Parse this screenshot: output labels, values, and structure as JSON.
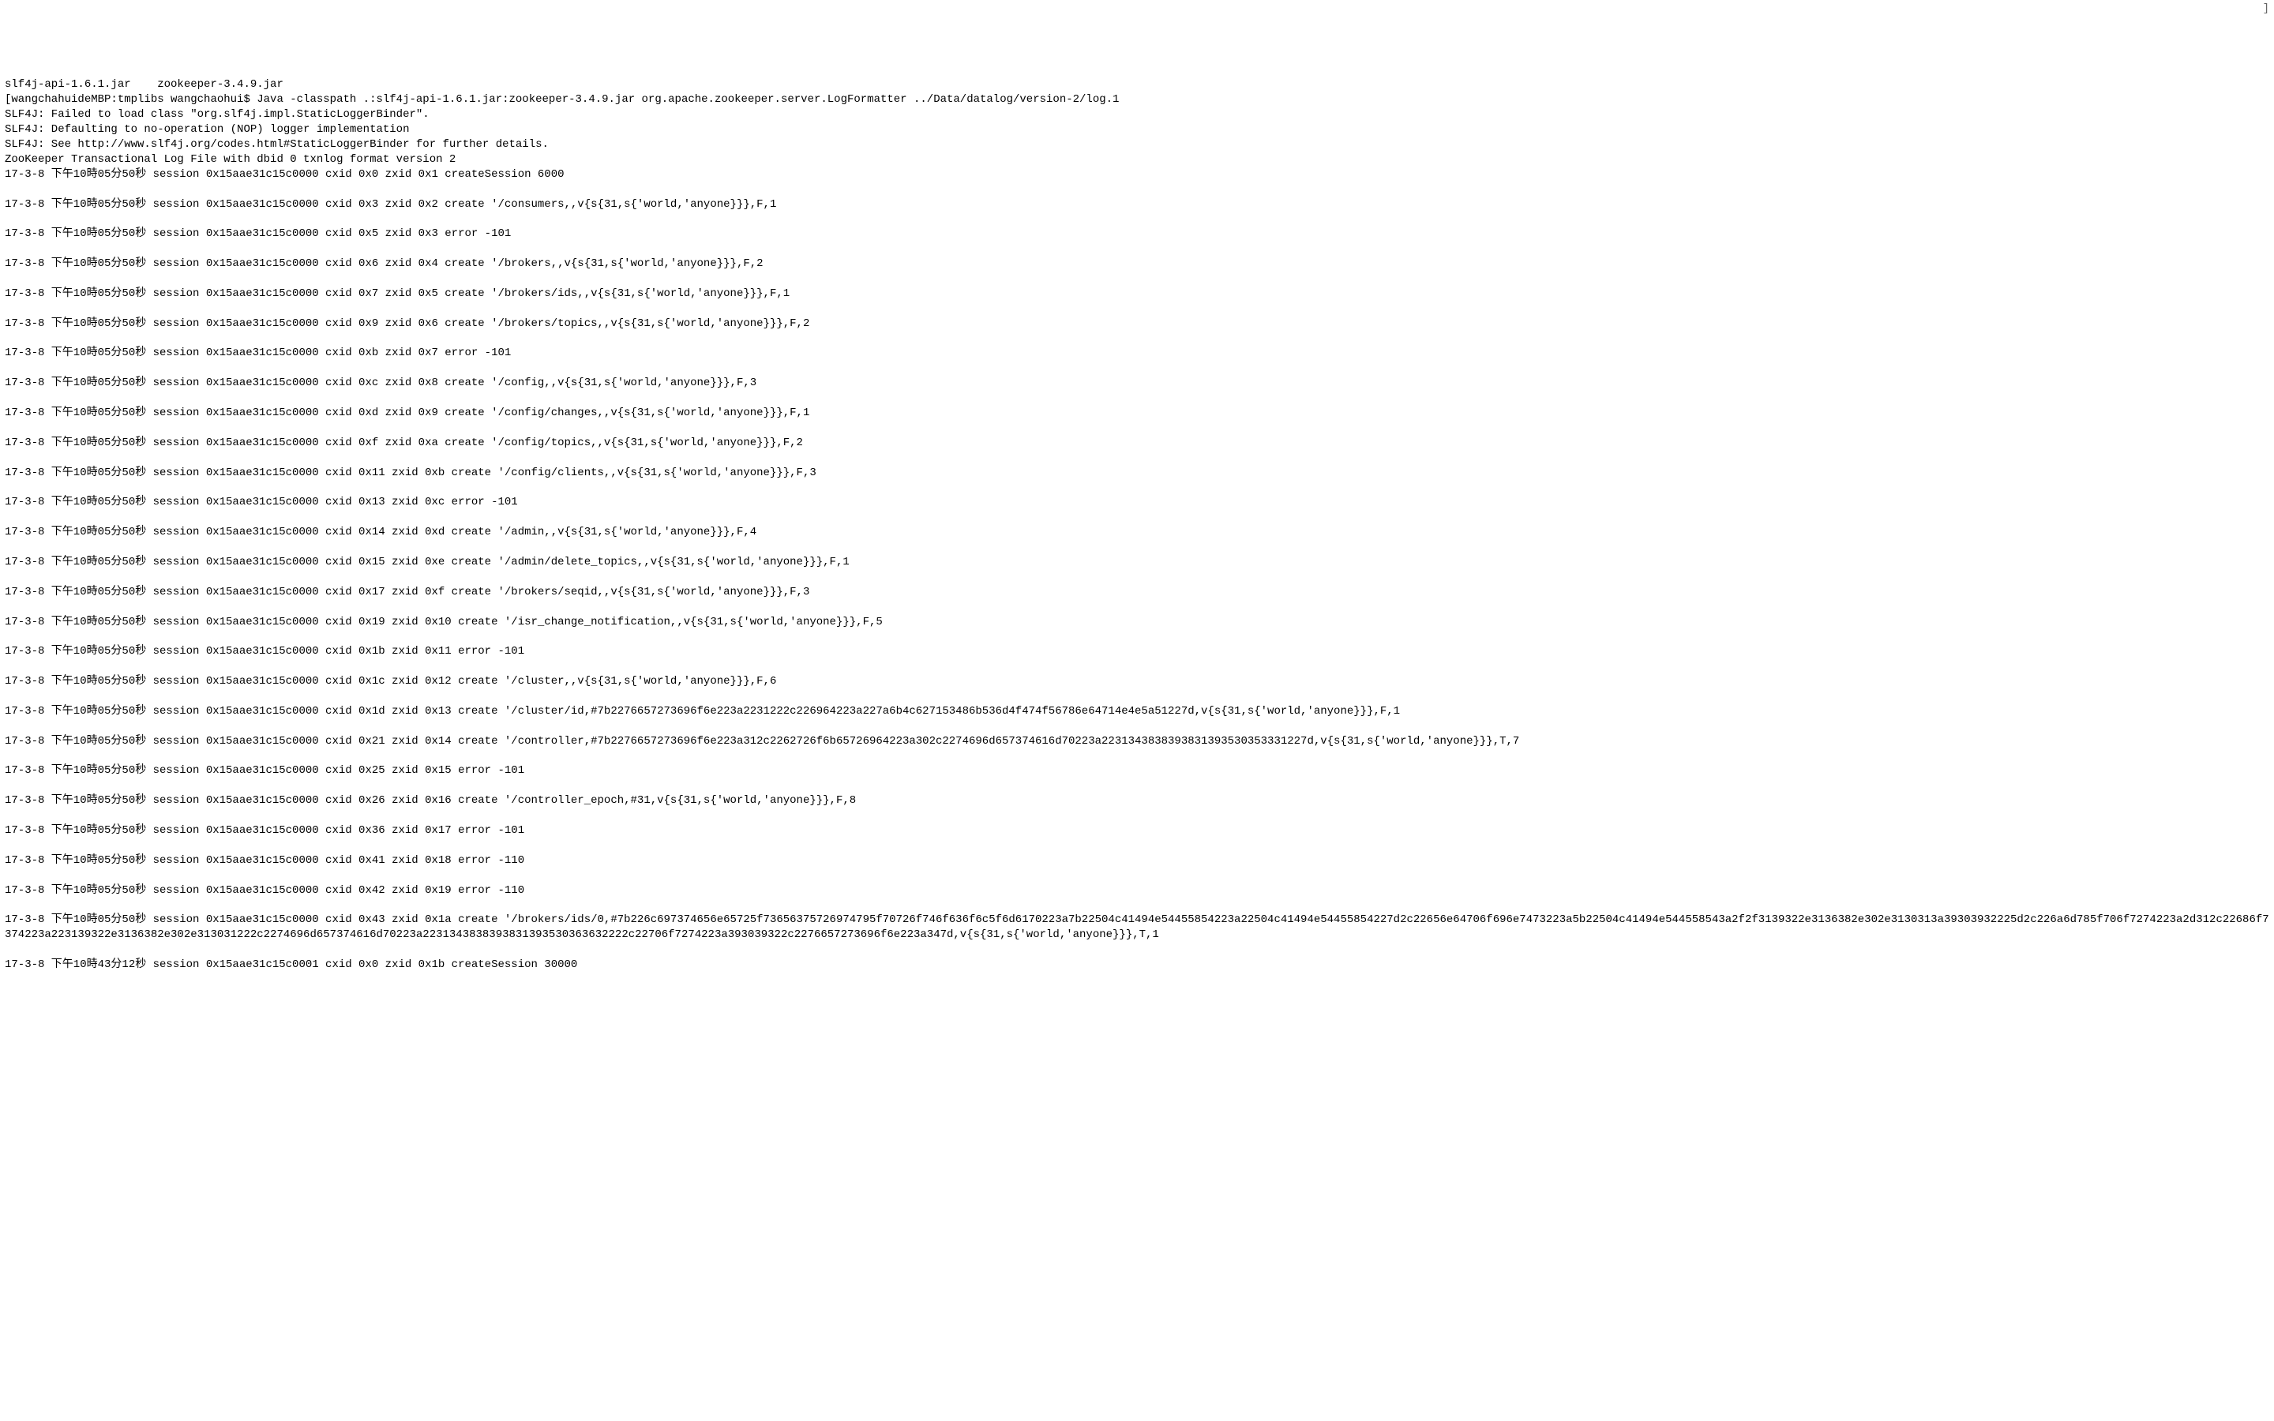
{
  "cursor": "]",
  "lines": [
    "slf4j-api-1.6.1.jar    zookeeper-3.4.9.jar",
    "[wangchahuideMBP:tmplibs wangchaohui$ Java -classpath .:slf4j-api-1.6.1.jar:zookeeper-3.4.9.jar org.apache.zookeeper.server.LogFormatter ../Data/datalog/version-2/log.1",
    "SLF4J: Failed to load class \"org.slf4j.impl.StaticLoggerBinder\".",
    "SLF4J: Defaulting to no-operation (NOP) logger implementation",
    "SLF4J: See http://www.slf4j.org/codes.html#StaticLoggerBinder for further details.",
    "ZooKeeper Transactional Log File with dbid 0 txnlog format version 2",
    "17-3-8 下午10時05分50秒 session 0x15aae31c15c0000 cxid 0x0 zxid 0x1 createSession 6000",
    "",
    "17-3-8 下午10時05分50秒 session 0x15aae31c15c0000 cxid 0x3 zxid 0x2 create '/consumers,,v{s{31,s{'world,'anyone}}},F,1",
    "",
    "17-3-8 下午10時05分50秒 session 0x15aae31c15c0000 cxid 0x5 zxid 0x3 error -101",
    "",
    "17-3-8 下午10時05分50秒 session 0x15aae31c15c0000 cxid 0x6 zxid 0x4 create '/brokers,,v{s{31,s{'world,'anyone}}},F,2",
    "",
    "17-3-8 下午10時05分50秒 session 0x15aae31c15c0000 cxid 0x7 zxid 0x5 create '/brokers/ids,,v{s{31,s{'world,'anyone}}},F,1",
    "",
    "17-3-8 下午10時05分50秒 session 0x15aae31c15c0000 cxid 0x9 zxid 0x6 create '/brokers/topics,,v{s{31,s{'world,'anyone}}},F,2",
    "",
    "17-3-8 下午10時05分50秒 session 0x15aae31c15c0000 cxid 0xb zxid 0x7 error -101",
    "",
    "17-3-8 下午10時05分50秒 session 0x15aae31c15c0000 cxid 0xc zxid 0x8 create '/config,,v{s{31,s{'world,'anyone}}},F,3",
    "",
    "17-3-8 下午10時05分50秒 session 0x15aae31c15c0000 cxid 0xd zxid 0x9 create '/config/changes,,v{s{31,s{'world,'anyone}}},F,1",
    "",
    "17-3-8 下午10時05分50秒 session 0x15aae31c15c0000 cxid 0xf zxid 0xa create '/config/topics,,v{s{31,s{'world,'anyone}}},F,2",
    "",
    "17-3-8 下午10時05分50秒 session 0x15aae31c15c0000 cxid 0x11 zxid 0xb create '/config/clients,,v{s{31,s{'world,'anyone}}},F,3",
    "",
    "17-3-8 下午10時05分50秒 session 0x15aae31c15c0000 cxid 0x13 zxid 0xc error -101",
    "",
    "17-3-8 下午10時05分50秒 session 0x15aae31c15c0000 cxid 0x14 zxid 0xd create '/admin,,v{s{31,s{'world,'anyone}}},F,4",
    "",
    "17-3-8 下午10時05分50秒 session 0x15aae31c15c0000 cxid 0x15 zxid 0xe create '/admin/delete_topics,,v{s{31,s{'world,'anyone}}},F,1",
    "",
    "17-3-8 下午10時05分50秒 session 0x15aae31c15c0000 cxid 0x17 zxid 0xf create '/brokers/seqid,,v{s{31,s{'world,'anyone}}},F,3",
    "",
    "17-3-8 下午10時05分50秒 session 0x15aae31c15c0000 cxid 0x19 zxid 0x10 create '/isr_change_notification,,v{s{31,s{'world,'anyone}}},F,5",
    "",
    "17-3-8 下午10時05分50秒 session 0x15aae31c15c0000 cxid 0x1b zxid 0x11 error -101",
    "",
    "17-3-8 下午10時05分50秒 session 0x15aae31c15c0000 cxid 0x1c zxid 0x12 create '/cluster,,v{s{31,s{'world,'anyone}}},F,6",
    "",
    "17-3-8 下午10時05分50秒 session 0x15aae31c15c0000 cxid 0x1d zxid 0x13 create '/cluster/id,#7b2276657273696f6e223a2231222c226964223a227a6b4c627153486b536d4f474f56786e64714e4e5a51227d,v{s{31,s{'world,'anyone}}},F,1",
    "",
    "17-3-8 下午10時05分50秒 session 0x15aae31c15c0000 cxid 0x21 zxid 0x14 create '/controller,#7b2276657273696f6e223a312c2262726f6b65726964223a302c2274696d657374616d70223a2231343838393831393530353331227d,v{s{31,s{'world,'anyone}}},T,7",
    "",
    "17-3-8 下午10時05分50秒 session 0x15aae31c15c0000 cxid 0x25 zxid 0x15 error -101",
    "",
    "17-3-8 下午10時05分50秒 session 0x15aae31c15c0000 cxid 0x26 zxid 0x16 create '/controller_epoch,#31,v{s{31,s{'world,'anyone}}},F,8",
    "",
    "17-3-8 下午10時05分50秒 session 0x15aae31c15c0000 cxid 0x36 zxid 0x17 error -101",
    "",
    "17-3-8 下午10時05分50秒 session 0x15aae31c15c0000 cxid 0x41 zxid 0x18 error -110",
    "",
    "17-3-8 下午10時05分50秒 session 0x15aae31c15c0000 cxid 0x42 zxid 0x19 error -110",
    "",
    "17-3-8 下午10時05分50秒 session 0x15aae31c15c0000 cxid 0x43 zxid 0x1a create '/brokers/ids/0,#7b226c697374656e65725f73656375726974795f70726f746f636f6c5f6d6170223a7b22504c41494e54455854223a22504c41494e54455854227d2c22656e64706f696e7473223a5b22504c41494e544558543a2f2f3139322e3136382e302e3130313a39303932225d2c226a6d785f706f7274223a2d312c22686f7374223a223139322e3136382e302e313031222c2274696d657374616d70223a2231343838393831393530363632222c22706f7274223a393039322c2276657273696f6e223a347d,v{s{31,s{'world,'anyone}}},T,1",
    "",
    "17-3-8 下午10時43分12秒 session 0x15aae31c15c0001 cxid 0x0 zxid 0x1b createSession 30000"
  ]
}
